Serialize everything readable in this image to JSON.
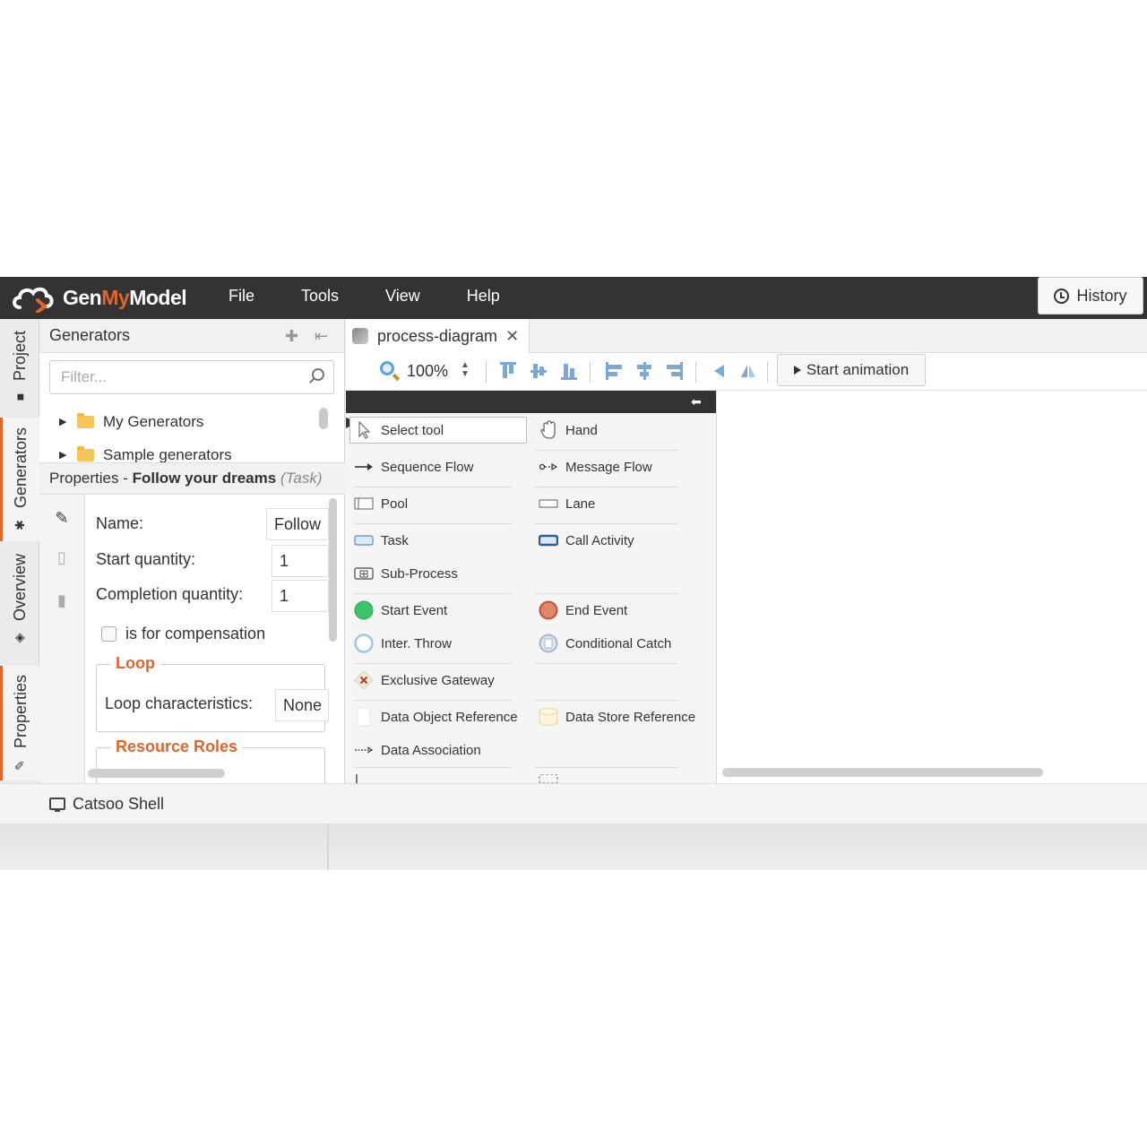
{
  "app": {
    "logo": {
      "part1": "Gen",
      "part2": "My",
      "part3": "Model"
    },
    "menu": [
      "File",
      "Tools",
      "View",
      "Help"
    ],
    "history_label": "History"
  },
  "vertical_tabs": {
    "project": "Project",
    "generators": "Generators",
    "overview": "Overview",
    "properties": "Properties"
  },
  "generators_panel": {
    "title": "Generators",
    "filter_placeholder": "Filter...",
    "tree": [
      "My Generators",
      "Sample generators"
    ]
  },
  "properties_panel": {
    "title_prefix": "Properties - ",
    "element_name": "Follow your dreams",
    "element_type": "(Task)",
    "name_label": "Name:",
    "name_value": "Follow",
    "start_quantity_label": "Start quantity:",
    "start_quantity_value": "1",
    "completion_quantity_label": "Completion quantity:",
    "completion_quantity_value": "1",
    "compensation_label": "is for compensation",
    "loop_legend": "Loop",
    "loop_characteristics_label": "Loop characteristics:",
    "loop_characteristics_value": "None",
    "resource_roles_legend": "Resource Roles"
  },
  "editor": {
    "tab_label": "process-diagram",
    "zoom": "100%",
    "start_animation": "Start animation"
  },
  "palette": {
    "select_tool": "Select tool",
    "hand": "Hand",
    "sequence_flow": "Sequence Flow",
    "message_flow": "Message Flow",
    "pool": "Pool",
    "lane": "Lane",
    "task": "Task",
    "call_activity": "Call Activity",
    "sub_process": "Sub-Process",
    "start_event": "Start Event",
    "end_event": "End Event",
    "inter_throw": "Inter. Throw",
    "conditional_catch": "Conditional Catch",
    "exclusive_gateway": "Exclusive Gateway",
    "data_object_reference": "Data Object Reference",
    "data_store_reference": "Data Store Reference",
    "data_association": "Data Association"
  },
  "bottom": {
    "shell_label": "Catsoo Shell"
  },
  "colors": {
    "accent": "#e0662b",
    "topbar": "#333333",
    "start_event": "#3cc46a",
    "end_event": "#e0866b"
  }
}
